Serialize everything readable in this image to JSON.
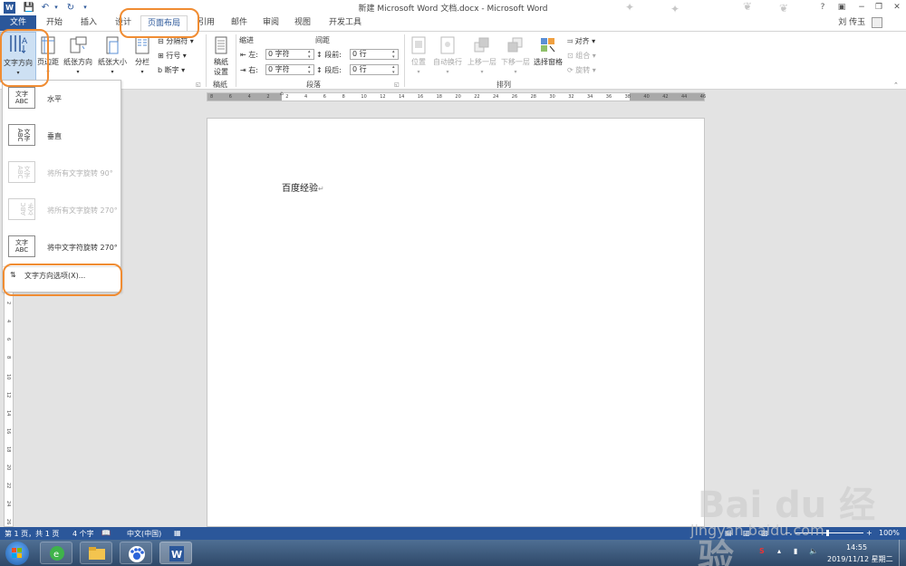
{
  "window": {
    "title": "新建 Microsoft Word 文档.docx - Microsoft Word",
    "help": "?",
    "min": "−",
    "restore": "❐",
    "close": "✕",
    "user": "刘 传玉"
  },
  "tabs": [
    "文件",
    "开始",
    "插入",
    "设计",
    "页面布局",
    "引用",
    "邮件",
    "审阅",
    "视图",
    "开发工具"
  ],
  "ribbon": {
    "text_direction": "文字方向",
    "margins": "页边距",
    "orientation": "纸张方向",
    "size": "纸张大小",
    "columns": "分栏",
    "breaks": "分隔符",
    "line_numbers": "行号",
    "hyphenation": "断字",
    "manuscript": "稿纸",
    "manuscript_setup_line1": "稿纸",
    "manuscript_setup_line2": "设置",
    "group_manuscript": "稿纸",
    "indent": "缩进",
    "spacing": "间距",
    "left": "左:",
    "right": "右:",
    "before": "段前:",
    "after": "段后:",
    "indent_left": "0 字符",
    "indent_right": "0 字符",
    "space_before": "0 行",
    "space_after": "0 行",
    "group_paragraph": "段落",
    "position": "位置",
    "wrap": "自动换行",
    "forward": "上移一层",
    "backward": "下移一层",
    "selection_pane": "选择窗格",
    "align": "对齐",
    "group": "组合",
    "rotate": "旋转",
    "group_arrange": "排列"
  },
  "ruler": {
    "h": [
      "8",
      "6",
      "4",
      "2",
      "2",
      "4",
      "6",
      "8",
      "10",
      "12",
      "14",
      "16",
      "18",
      "20",
      "22",
      "24",
      "26",
      "28",
      "30",
      "32",
      "34",
      "36",
      "38",
      "40",
      "42",
      "44",
      "46"
    ],
    "v": [
      "2",
      "4",
      "6",
      "8",
      "10",
      "12",
      "14",
      "16",
      "18",
      "20",
      "22",
      "24",
      "26"
    ]
  },
  "document": {
    "text": "百度经验"
  },
  "dropdown": {
    "items": [
      {
        "icon": "文字 ABC",
        "label": "水平",
        "enabled": true
      },
      {
        "icon": "文字ABC",
        "label": "垂直",
        "enabled": true
      },
      {
        "icon": "文字ABC",
        "label": "将所有文字旋转 90°",
        "enabled": false
      },
      {
        "icon": "文字ABC",
        "label": "将所有文字旋转 270°",
        "enabled": false
      },
      {
        "icon": "文字 ABC",
        "label": "将中文字符旋转 270°",
        "enabled": true
      }
    ],
    "options": "文字方向选项(X)..."
  },
  "status": {
    "page": "第 1 页，共 1 页",
    "words": "4 个字",
    "lang": "中文(中国)",
    "zoom": "100%"
  },
  "taskbar": {
    "time": "14:55",
    "date": "2019/11/12 星期二"
  },
  "watermark": {
    "brand": "Bai du 经验",
    "url": "jingyan.baidu.com"
  },
  "colors": {
    "accent": "#2b579a",
    "highlight": "#f08c32"
  }
}
